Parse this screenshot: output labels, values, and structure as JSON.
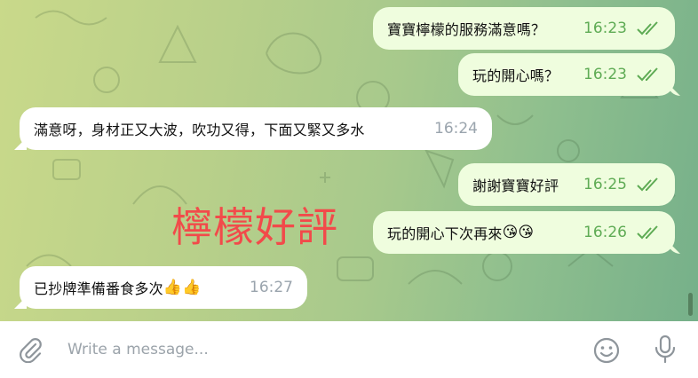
{
  "messages": [
    {
      "id": "m1",
      "direction": "out",
      "text": "寶寶檸檬的服務滿意嗎？",
      "time": "16:23",
      "read": true
    },
    {
      "id": "m2",
      "direction": "out",
      "text": "玩的開心嗎？",
      "time": "16:23",
      "read": true
    },
    {
      "id": "m3",
      "direction": "in",
      "text": "滿意呀，身材正又大波，吹功又得，下面又緊又多水",
      "time": "16:24"
    },
    {
      "id": "m4",
      "direction": "out",
      "text": "謝謝寶寶好評",
      "time": "16:25",
      "read": true
    },
    {
      "id": "m5",
      "direction": "out",
      "text": "玩的開心下次再來",
      "emoji": "😘😘",
      "time": "16:26",
      "read": true
    },
    {
      "id": "m6",
      "direction": "in",
      "text": "已抄牌準備番食多次",
      "emoji": "👍👍",
      "time": "16:27"
    }
  ],
  "overlay_text": "檸檬好評",
  "composer": {
    "placeholder": "Write a message...",
    "icons": {
      "attach": "paperclip-icon",
      "emoji": "smiley-icon",
      "voice": "microphone-icon"
    }
  },
  "colors": {
    "outgoing_bubble": "#effdde",
    "incoming_bubble": "#ffffff",
    "outgoing_time": "#5eab54",
    "incoming_time": "#9aa4ad",
    "overlay_text": "#f24a4a"
  }
}
